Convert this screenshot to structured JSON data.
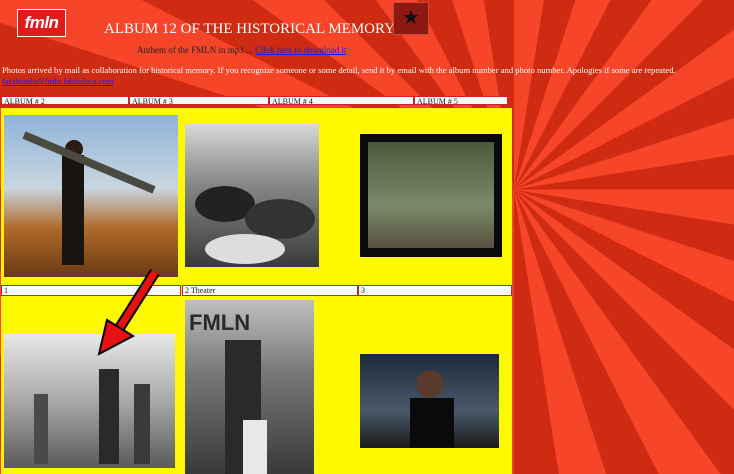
{
  "header": {
    "logo_text": "fmln",
    "title": "ALBUM 12 OF THE HISTORICAL MEMORY",
    "anthem_text": "Anthem of the FMLN in mp3 ... ",
    "download_link": "Click here to download it"
  },
  "intro": {
    "text": "Photos arrived by mail as collaboration for historical memory. If you recognize someone or some detail, send it by email with the album number and photo number. Apologies if some are repeated.",
    "email_link": "farabundo@fmln.fabiodeca.com"
  },
  "albums": [
    "ALBUM # 2",
    "ALBUM # 3",
    "ALBUM # 4",
    "ALBUM # 5"
  ],
  "photos_row1": [
    {
      "caption": "1",
      "icon": "soldier-with-rocket-launcher-photo"
    },
    {
      "caption": "2 Theater",
      "icon": "crowd-sitting-photo"
    },
    {
      "caption": "3",
      "icon": "guerrilla-youths-photo"
    }
  ],
  "photos_row2": [
    {
      "icon": "village-group-photo"
    },
    {
      "icon": "fmln-guerrillas-photo"
    },
    {
      "icon": "young-fighters-photo"
    }
  ],
  "colors": {
    "background": "#e8361a",
    "cell_yellow": "#fff900",
    "link_blue": "#1a1aff"
  }
}
